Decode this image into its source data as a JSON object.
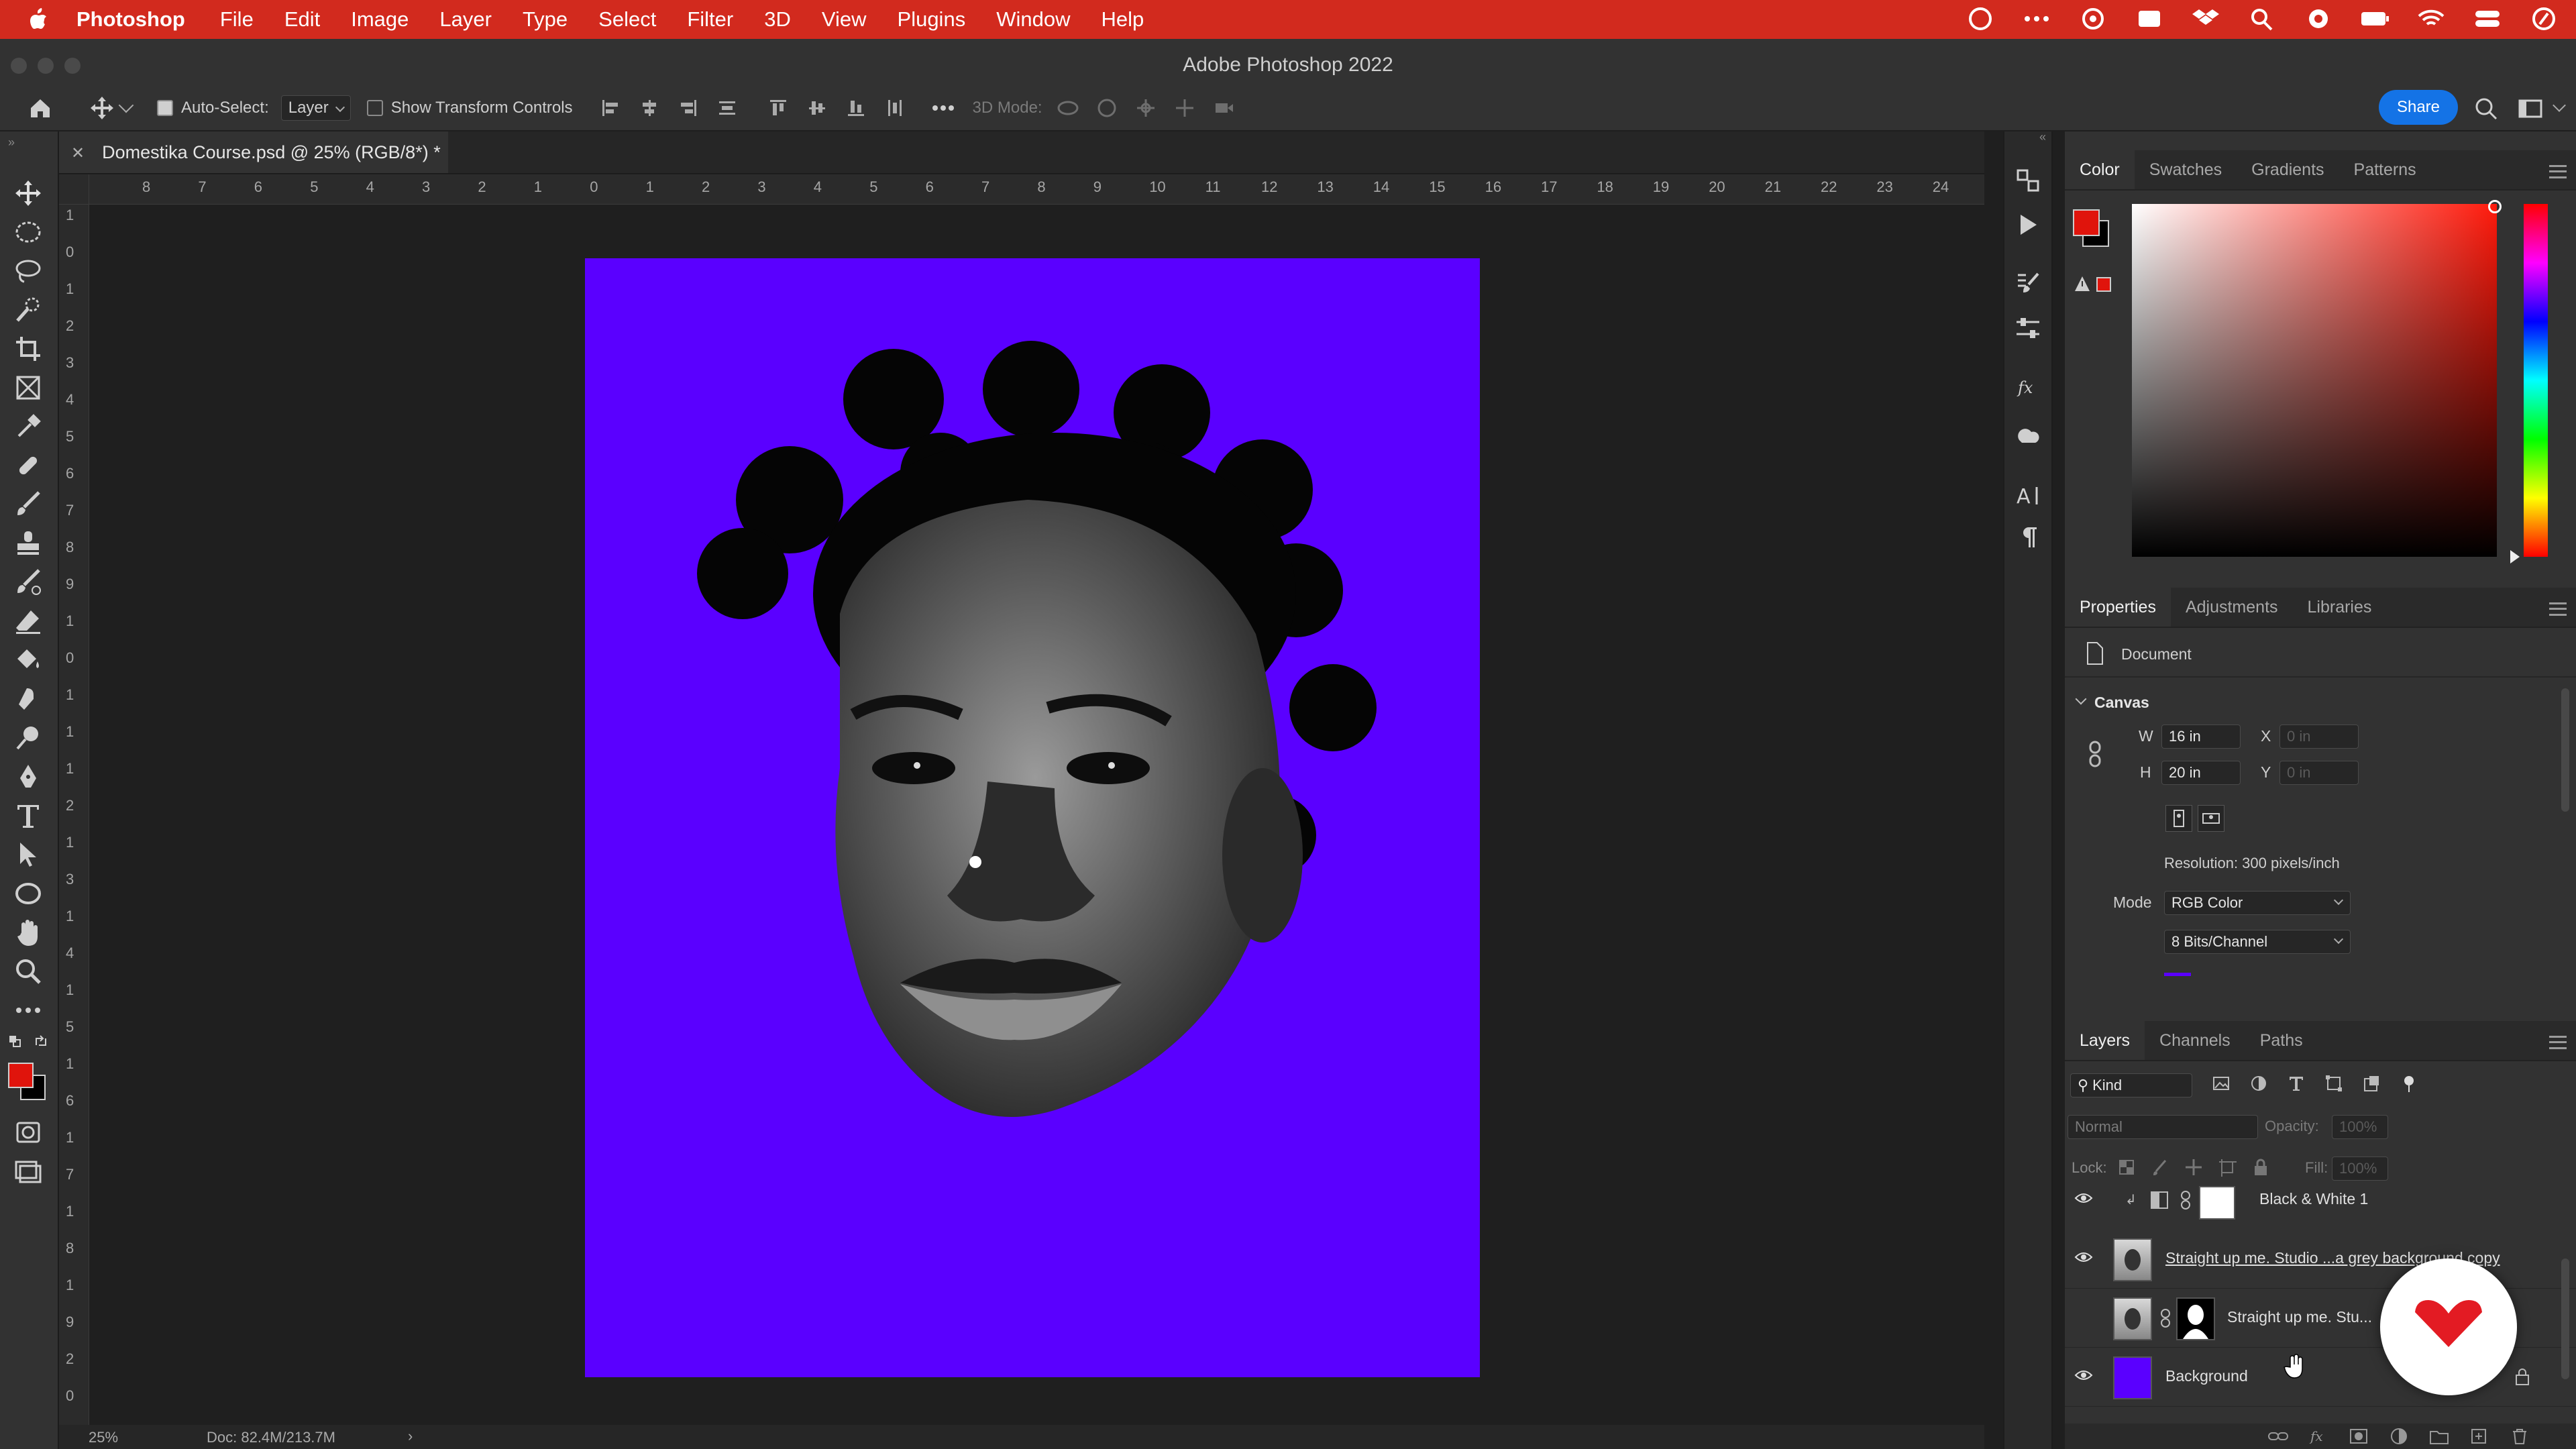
{
  "menubar": {
    "app_name": "Photoshop",
    "items": [
      "File",
      "Edit",
      "Image",
      "Layer",
      "Type",
      "Select",
      "Filter",
      "3D",
      "View",
      "Plugins",
      "Window",
      "Help"
    ]
  },
  "window": {
    "title": "Adobe Photoshop 2022"
  },
  "options_bar": {
    "auto_select_label": "Auto-Select:",
    "auto_select_value": "Layer",
    "show_transform_label": "Show Transform Controls",
    "mode_3d_label": "3D Mode:",
    "share_label": "Share"
  },
  "document": {
    "tab_title": "Domestika Course.psd @ 25% (RGB/8*) *",
    "canvas_color": "#5a00ff"
  },
  "rulers": {
    "top": [
      "8",
      "7",
      "6",
      "5",
      "4",
      "3",
      "2",
      "1",
      "0",
      "1",
      "2",
      "3",
      "4",
      "5",
      "6",
      "7",
      "8",
      "9",
      "10",
      "11",
      "12",
      "13",
      "14",
      "15",
      "16",
      "17",
      "18",
      "19",
      "20",
      "21",
      "22",
      "23",
      "24"
    ],
    "left": [
      "1",
      "0",
      "1",
      "2",
      "3",
      "4",
      "5",
      "6",
      "7",
      "8",
      "9",
      "1",
      "0",
      "1",
      "1",
      "1",
      "2",
      "1",
      "3",
      "1",
      "4",
      "1",
      "5",
      "1",
      "6",
      "1",
      "7",
      "1",
      "8",
      "1",
      "9",
      "2",
      "0"
    ]
  },
  "status": {
    "zoom": "25%",
    "doc": "Doc: 82.4M/213.7M"
  },
  "color_panel": {
    "tabs": [
      "Color",
      "Swatches",
      "Gradients",
      "Patterns"
    ],
    "foreground": "#e0140c",
    "background": "#000000"
  },
  "properties_panel": {
    "tabs": [
      "Properties",
      "Adjustments",
      "Libraries"
    ],
    "section": "Document",
    "canvas_heading": "Canvas",
    "w_label": "W",
    "w_value": "16 in",
    "h_label": "H",
    "h_value": "20 in",
    "x_label": "X",
    "x_value": "0 in",
    "y_label": "Y",
    "y_value": "0 in",
    "resolution": "Resolution: 300 pixels/inch",
    "mode_label": "Mode",
    "mode_value": "RGB Color",
    "bits_value": "8 Bits/Channel"
  },
  "layers_panel": {
    "tabs": [
      "Layers",
      "Channels",
      "Paths"
    ],
    "filter_kind": "Kind",
    "blend_mode": "Normal",
    "opacity_label": "Opacity:",
    "opacity_value": "100%",
    "lock_label": "Lock:",
    "fill_label": "Fill:",
    "fill_value": "100%",
    "layers": [
      {
        "name": "Black & White 1",
        "visible": true
      },
      {
        "name": "Straight up me. Studio ...a grey background copy",
        "visible": true
      },
      {
        "name": "Straight up me. Stu...",
        "visible": false
      },
      {
        "name": "Background",
        "visible": true
      }
    ]
  },
  "colors": {
    "accent": "#1473e6",
    "menubar": "#d22a1e",
    "logo_red": "#e31b23"
  }
}
